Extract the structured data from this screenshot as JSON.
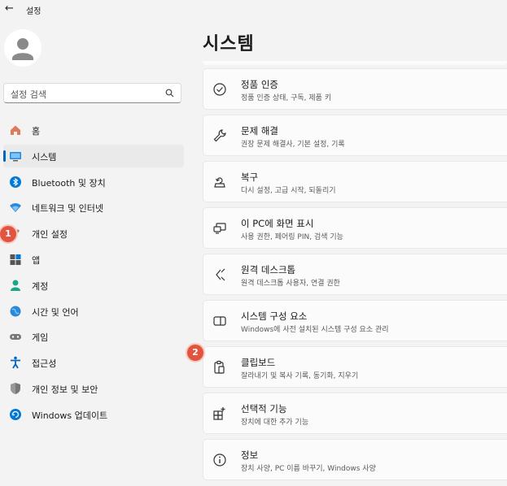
{
  "window": {
    "title": "설정",
    "back_glyph": "←"
  },
  "search": {
    "placeholder": "설정 검색"
  },
  "nav": {
    "items": [
      {
        "label": "홈",
        "icon": "home-icon"
      },
      {
        "label": "시스템",
        "icon": "system-icon",
        "active": true
      },
      {
        "label": "Bluetooth 및 장치",
        "icon": "bluetooth-icon"
      },
      {
        "label": "네트워크 및 인터넷",
        "icon": "network-icon"
      },
      {
        "label": "개인 설정",
        "icon": "personalization-icon"
      },
      {
        "label": "앱",
        "icon": "apps-icon"
      },
      {
        "label": "계정",
        "icon": "account-icon"
      },
      {
        "label": "시간 및 언어",
        "icon": "time-language-icon"
      },
      {
        "label": "게임",
        "icon": "gaming-icon"
      },
      {
        "label": "접근성",
        "icon": "accessibility-icon"
      },
      {
        "label": "개인 정보 및 보안",
        "icon": "privacy-shield-icon"
      },
      {
        "label": "Windows 업데이트",
        "icon": "windows-update-icon"
      }
    ]
  },
  "main": {
    "title": "시스템",
    "cards": [
      {
        "title": "정품 인증",
        "subtitle": "정품 인증 상태, 구독, 제품 키",
        "icon": "activation-check-icon"
      },
      {
        "title": "문제 해결",
        "subtitle": "권장 문제 해결사, 기본 설정, 기록",
        "icon": "wrench-icon"
      },
      {
        "title": "복구",
        "subtitle": "다시 설정, 고급 시작, 되돌리기",
        "icon": "recovery-icon"
      },
      {
        "title": "이 PC에 화면 표시",
        "subtitle": "사용 권한, 페어링 PIN, 검색 기능",
        "icon": "project-to-pc-icon"
      },
      {
        "title": "원격 데스크톱",
        "subtitle": "원격 데스크톱 사용자, 연결 권한",
        "icon": "remote-desktop-icon"
      },
      {
        "title": "시스템 구성 요소",
        "subtitle": "Windows에 사전 설치된 시스템 구성 요소 관리",
        "icon": "system-components-icon"
      },
      {
        "title": "클립보드",
        "subtitle": "잘라내기 및 복사 기록, 동기화, 지우기",
        "icon": "clipboard-icon"
      },
      {
        "title": "선택적 기능",
        "subtitle": "장치에 대한 추가 기능",
        "icon": "optional-features-icon"
      },
      {
        "title": "정보",
        "subtitle": "장치 사양, PC 이름 바꾸기, Windows 사양",
        "icon": "info-icon"
      }
    ]
  },
  "annotations": {
    "badge_1": "1",
    "badge_2": "2"
  },
  "colors": {
    "accent": "#0067c0",
    "badge": "#e2543f",
    "background": "#f3f3f3",
    "card": "#fbfbfb"
  }
}
